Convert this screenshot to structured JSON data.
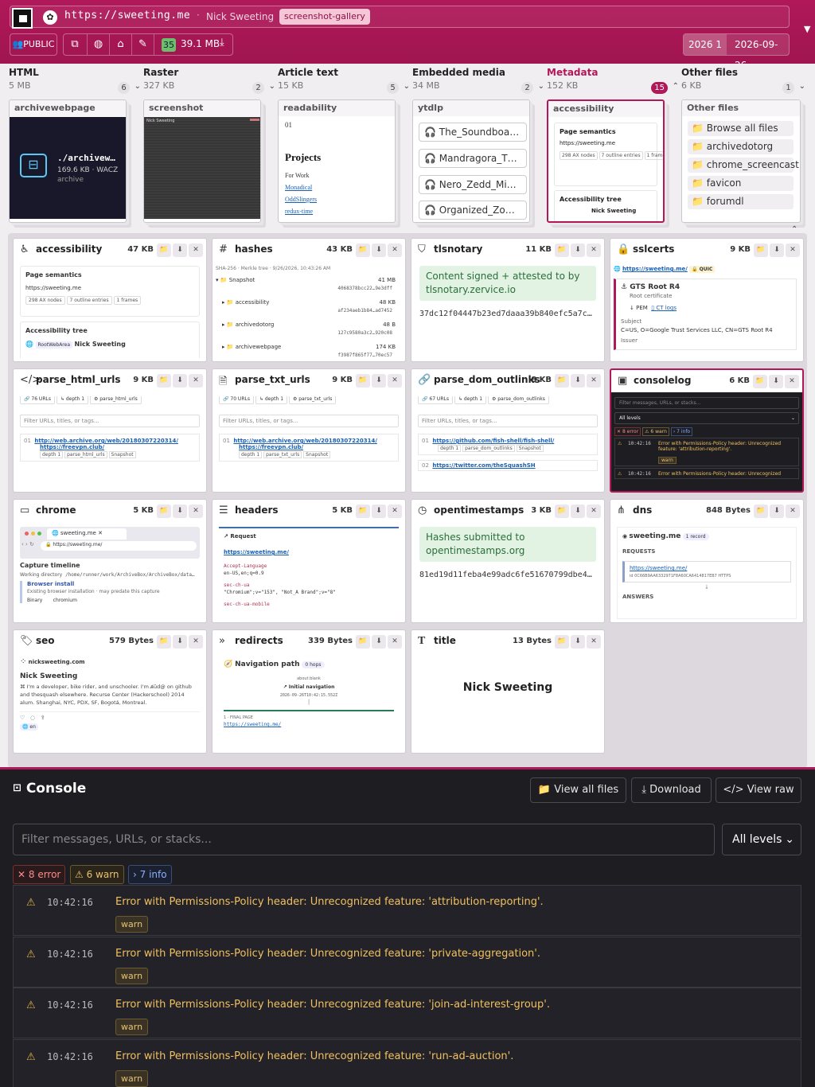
{
  "header": {
    "url": "https://sweeting.me",
    "page_title": "Nick Sweeting",
    "tag": "screenshot-gallery",
    "public_label": "👥PUBLIC",
    "file_count": "35",
    "total_size": "39.1 MB",
    "year_label": "2026 1",
    "date": "2026-09-26"
  },
  "categories": [
    {
      "name": "HTML",
      "size": "5 MB",
      "count": "6"
    },
    {
      "name": "Raster",
      "size": "327 KB",
      "count": "2"
    },
    {
      "name": "Article text",
      "size": "15 KB",
      "count": "5"
    },
    {
      "name": "Embedded media",
      "size": "34 MB",
      "count": "2"
    },
    {
      "name": "Metadata",
      "size": "152 KB",
      "count": "15"
    },
    {
      "name": "Other files",
      "size": "6 KB",
      "count": "1"
    }
  ],
  "previews": {
    "archivewebpage": {
      "label": "archivewebpage",
      "file": "./archivew…",
      "meta": "169.6 KB · WACZ",
      "sub": "archive"
    },
    "screenshot": {
      "label": "screenshot",
      "mini": "Nick Sweeting"
    },
    "readability": {
      "label": "readability",
      "num": "01",
      "heading": "Projects",
      "line1": "For Work",
      "links": [
        "Monadical",
        "OddSlingers",
        "redux-time"
      ]
    },
    "ytdlp": {
      "label": "ytdlp",
      "items": [
        "The_Soundboa…",
        "Mandragora_T…",
        "Nero_Zedd_Mi…",
        "Organized_Zo…"
      ]
    },
    "accessibility": {
      "label": "accessibility",
      "sem": "Page semantics",
      "url": "https://sweeting.me",
      "chips": [
        "298 AX nodes",
        "7 outline entries",
        "1 frames"
      ],
      "tree": "Accessibility tree",
      "node": "Nick Sweeting"
    },
    "other": {
      "label": "Other files",
      "items": [
        "Browse all files",
        "archivedotorg",
        "chrome_screencast",
        "favicon",
        "forumdl"
      ]
    }
  },
  "cards": [
    {
      "title": "accessibility",
      "size": "47 KB",
      "icon": "accessibility-icon"
    },
    {
      "title": "hashes",
      "size": "43 KB",
      "icon": "hash-icon"
    },
    {
      "title": "tlsnotary",
      "size": "11 KB",
      "icon": "shield-check-icon"
    },
    {
      "title": "sslcerts",
      "size": "9 KB",
      "icon": "lock-icon"
    },
    {
      "title": "parse_html_urls",
      "size": "9 KB",
      "icon": "code-icon"
    },
    {
      "title": "parse_txt_urls",
      "size": "9 KB",
      "icon": "document-icon"
    },
    {
      "title": "parse_dom_outlinks",
      "size": "8 KB",
      "icon": "link-icon"
    },
    {
      "title": "consolelog",
      "size": "6 KB",
      "icon": "terminal-icon"
    },
    {
      "title": "chrome",
      "size": "5 KB",
      "icon": "browser-window-icon"
    },
    {
      "title": "headers",
      "size": "5 KB",
      "icon": "list-icon"
    },
    {
      "title": "opentimestamps",
      "size": "3 KB",
      "icon": "clock-icon"
    },
    {
      "title": "dns",
      "size": "848 Bytes",
      "icon": "share-nodes-icon"
    },
    {
      "title": "seo",
      "size": "579 Bytes",
      "icon": "tag-icon"
    },
    {
      "title": "redirects",
      "size": "339 Bytes",
      "icon": "double-chevron-right-icon"
    },
    {
      "title": "title",
      "size": "13 Bytes",
      "icon": "text-t-icon"
    }
  ],
  "card_content": {
    "acc": {
      "sem": "Page semantics",
      "url": "https://sweeting.me",
      "chips": [
        "298 AX nodes",
        "7 outline entries",
        "1 frames"
      ],
      "tree": "Accessibility tree",
      "role": "RootWebArea",
      "node": "Nick Sweeting"
    },
    "hashes": {
      "meta": "SHA-256 · Merkle tree · 9/26/2026, 10:43:26 AM",
      "rows": [
        {
          "name": "Snapshot",
          "size": "41 MB",
          "hash": "4068378bcc22…9e3dff"
        },
        {
          "name": "accessibility",
          "size": "48 KB",
          "hash": "af234aeb1b84…ad7452"
        },
        {
          "name": "archivedotorg",
          "size": "48 B",
          "hash": "127c9580a3c2…920c08"
        },
        {
          "name": "archivewebpage",
          "size": "174 KB",
          "hash": "f3987f865f77…70ec57"
        }
      ]
    },
    "tls": {
      "msg": "Content signed + attested to by tlsnotary.zervice.io",
      "hash": "37dc12f04447b23ed7daaa39b840efc5a7c…"
    },
    "ssl": {
      "url": "https://sweeting.me/",
      "quic": "QUIC",
      "root": "GTS Root R4",
      "rootsub": "Root certificate",
      "pem": "PEM",
      "ct": "CT logs",
      "subjlabel": "Subject",
      "subj": "C=US, O=Google Trust Services LLC, CN=GTS Root R4",
      "issuer": "Issuer"
    },
    "phu": {
      "chips": [
        "76 URLs",
        "depth 1",
        "parse_html_urls"
      ],
      "filter": "Filter URLs, titles, or tags...",
      "num": "01",
      "u1": "http://web.archive.org/web/20180307220314/",
      "u2": "https://freevpn.club/",
      "tags": [
        "depth 1",
        "parse_html_urls",
        "Snapshot"
      ]
    },
    "ptu": {
      "chips": [
        "70 URLs",
        "depth 1",
        "parse_txt_urls"
      ],
      "filter": "Filter URLs, titles, or tags...",
      "num": "01",
      "u1": "http://web.archive.org/web/20180307220314/",
      "u2": "https://freevpn.club/",
      "tags": [
        "depth 1",
        "parse_txt_urls",
        "Snapshot"
      ]
    },
    "pdo": {
      "chips": [
        "67 URLs",
        "depth 1",
        "parse_dom_outlinks"
      ],
      "filter": "Filter URLs, titles, or tags...",
      "num": "01",
      "u1": "https://github.com/fish-shell/fish-shell/",
      "tags": [
        "depth 1",
        "parse_dom_outlinks",
        "Snapshot"
      ],
      "num2": "02",
      "u2": "https://twitter.com/theSquashSH"
    },
    "cl": {
      "filter": "Filter messages, URLs, or stacks...",
      "level": "All levels",
      "pills": [
        "8 error",
        "6 warn",
        "7 info"
      ],
      "time": "10:42:16",
      "m1": "Error with Permissions-Policy header: Unrecognized feature: 'attribution-reporting'.",
      "warn": "warn",
      "m2": "Error with Permissions-Policy header: Unrecognized"
    },
    "chrome": {
      "tab": "sweeting.me",
      "url": "https://sweeting.me/",
      "cap": "Capture timeline",
      "wdlabel": "Working directory",
      "wd": "/home/runner/work/ArchiveBox/ArchiveBox/data…",
      "bi": "Browser install",
      "bisub": "Existing browser installation · may predate this capture",
      "binlabel": "Binary",
      "bin": "chromium"
    },
    "headers": {
      "req": "Request",
      "url": "https://sweeting.me/",
      "h1": "Accept-Language",
      "v1": "en-US,en;q=0.9",
      "h2": "sec-ch-ua",
      "v2": "\"Chromium\";v=\"153\", \"Not_A Brand\";v=\"8\"",
      "h3": "sec-ch-ua-mobile"
    },
    "ots": {
      "msg": "Hashes submitted to opentimestamps.org",
      "hash": "81ed19d11feba4e99adc6fe51670799dbe4…"
    },
    "dns": {
      "domain": "sweeting.me",
      "rec": "1 record",
      "reqlabel": "REQUESTS",
      "url": "https://sweeting.me/",
      "id": "id 0C66B9AA6332971F8A60CA6414817EB7 HTTPS",
      "ans": "ANSWERS"
    },
    "seo": {
      "site": "nicksweeting.com",
      "title": "Nick Sweeting",
      "desc": "⌘ I'm a developer, bike rider, and unschooler. I'm a̸ūd@ on github and thesquash elsewhere. Recurse Center (Hackerschool) 2014 alum. Shanghai, NYC, PDX, SF, Bogotá, Montreal.",
      "lang": "en"
    },
    "redir": {
      "label": "Navigation path",
      "hops": "0 hops",
      "blank": "about:blank",
      "init": "Initial navigation",
      "ts": "2026-09-26T10:42:15.552Z",
      "final": "1 · FINAL PAGE",
      "url": "https://sweeting.me/"
    },
    "title": {
      "text": "Nick Sweeting"
    }
  },
  "console": {
    "title": "Console",
    "view_all": "View all files",
    "download": "Download",
    "view_raw": "View raw",
    "filter_placeholder": "Filter messages, URLs, or stacks...",
    "level": "All levels",
    "error_pill": "✕ 8 error",
    "warn_pill": "⚠ 6 warn",
    "info_pill": "› 7 info",
    "rows": [
      {
        "time": "10:42:16",
        "msg": "Error with Permissions-Policy header: Unrecognized feature: 'attribution-reporting'.",
        "level": "warn"
      },
      {
        "time": "10:42:16",
        "msg": "Error with Permissions-Policy header: Unrecognized feature: 'private-aggregation'.",
        "level": "warn"
      },
      {
        "time": "10:42:16",
        "msg": "Error with Permissions-Policy header: Unrecognized feature: 'join-ad-interest-group'.",
        "level": "warn"
      },
      {
        "time": "10:42:16",
        "msg": "Error with Permissions-Policy header: Unrecognized feature: 'run-ad-auction'.",
        "level": "warn"
      }
    ]
  },
  "colors": {
    "accent": "#b0185a",
    "console_bg": "#1d1d22",
    "warn": "#f0c060",
    "success_bg": "#e2f3e4"
  }
}
